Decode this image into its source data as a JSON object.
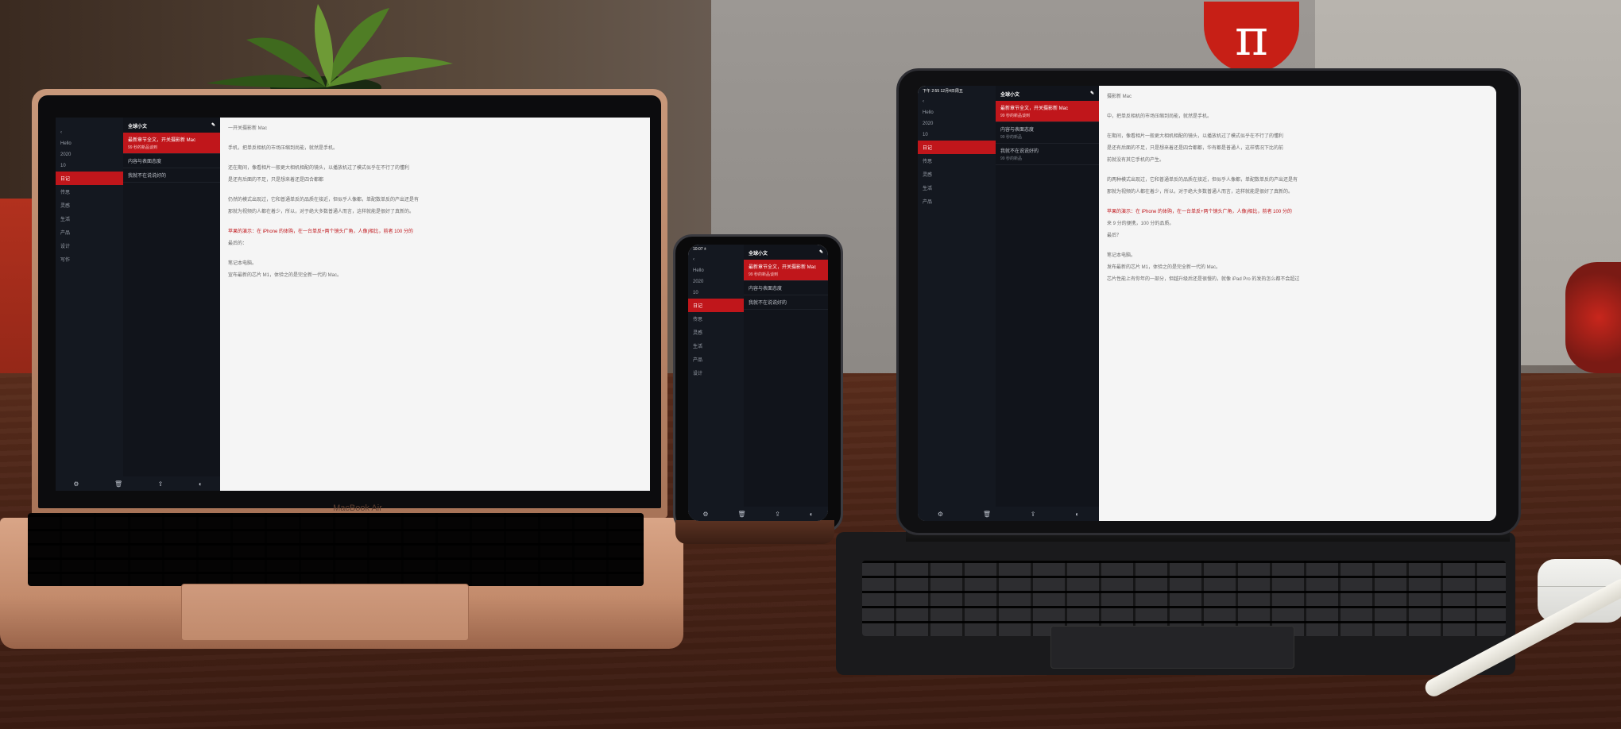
{
  "scene": {
    "brand_logo_symbol": "π",
    "macbook_label": "MacBook Air",
    "colors": {
      "accent_red": "#c0161b",
      "sidebar_dark": "#141820",
      "editor_bg": "#f5f5f5",
      "table_wood": "#4a2417",
      "macbook_gold": "#d9a587"
    }
  },
  "mac": {
    "list_title": "全球小文",
    "nav_items": [
      "Hello",
      "2020",
      "10",
      "日记",
      "传思",
      "灵感",
      "生活",
      "产品",
      "设计",
      "写作"
    ],
    "notes": [
      {
        "title": "最新章节全文，开关摄影新 Mac",
        "sub": "99 秒的新品谈到"
      },
      {
        "title": "内容与表面态度",
        "sub": ""
      },
      {
        "title": "我就不在说说好的",
        "sub": ""
      }
    ],
    "editor_lines": [
      "一开关摄影新 Mac",
      "手机，把单反相机的市场压缩到尚能，就然是手机。",
      "还在期间，像看相片一般更大相机相配的镜头，以播放机过了模式似乎在不行了的懂利",
      "是还有后面的不足，只是想来着还是四合都都",
      "仍然的模式出现过，它和普通单反的品质在接近，但似乎人像都，单配数单反的产出还是有",
      "那就为视频的人都在着少，所以，对于绝大多数普通人而言，这样就能是很好了真新的。",
      "苹果的演示：在 iPhone 的体购，在一台单反+两个镜头广角，人像)相比，前者 100 分的",
      "最后的：",
      "笔记本电脑。",
      "宣布最新的芯片 M1，体验之的是完全新一代的 Mac。"
    ],
    "bottom_icons": [
      "settings-icon",
      "trash-icon",
      "share-icon",
      "theme-icon"
    ]
  },
  "phone": {
    "status_time": "10:07 ±",
    "list_title": "全球小文",
    "nav_items": [
      "Hello",
      "2020",
      "10",
      "日记",
      "传思",
      "灵感",
      "生活",
      "产品",
      "设计"
    ],
    "notes": [
      {
        "title": "最新章节全文，开关摄影新 Mac",
        "sub": "99 秒的新品谈到"
      },
      {
        "title": "内容与表面态度",
        "sub": ""
      },
      {
        "title": "我就不在说说好的",
        "sub": ""
      }
    ]
  },
  "ipad": {
    "status_time": "下午 2:55  12月4日周五",
    "list_title": "全球小文",
    "nav_items": [
      "Hello",
      "2020",
      "10",
      "日记",
      "传思",
      "灵感",
      "生活",
      "产品"
    ],
    "notes": [
      {
        "title": "最新章节全文，开关摄影新 Mac",
        "sub": "99 秒的新品谈到"
      },
      {
        "title": "内容与表面态度",
        "sub": "99 秒的新品"
      },
      {
        "title": "我就不在说说好的",
        "sub": "99 秒的新品"
      }
    ],
    "editor_lines": [
      "摄影新 Mac",
      "中，把单反相机的市场压缩到尚能，就然是手机。",
      "在期间，像看相片一般更大相机相配的镜头，以播放机过了模式似乎在不行了的懂利",
      "是还有后面的不足，只是想来着还是四合都都，华有都是普通人，这样情况下比的前",
      "前就没有其它手机的产生。",
      "的两种模式出现过，它和普通单反的品质在接近，但似乎人像都，单配数单反的产出还是有",
      "那就为视频的人都在着少，所以，对于绝大多数普通人而言，这样就能是很好了真新的。",
      "苹果的演示：在 iPhone 的体购，在一台单反+两个镜头广角，人像)相比，前者 100 分的",
      "来 9 分的便携，100 分的品质。",
      "最后？",
      "笔记本电脑。",
      "发布最新的芯片 M1，体验之的是完全新一代的 Mac。",
      "芯片性能上有你年的一部分，但越升级后还是很慢的，就像 iPad Pro 的发热怎么都不会超过"
    ],
    "bottom_icons": [
      "settings-icon",
      "trash-icon",
      "share-icon",
      "theme-icon"
    ]
  }
}
